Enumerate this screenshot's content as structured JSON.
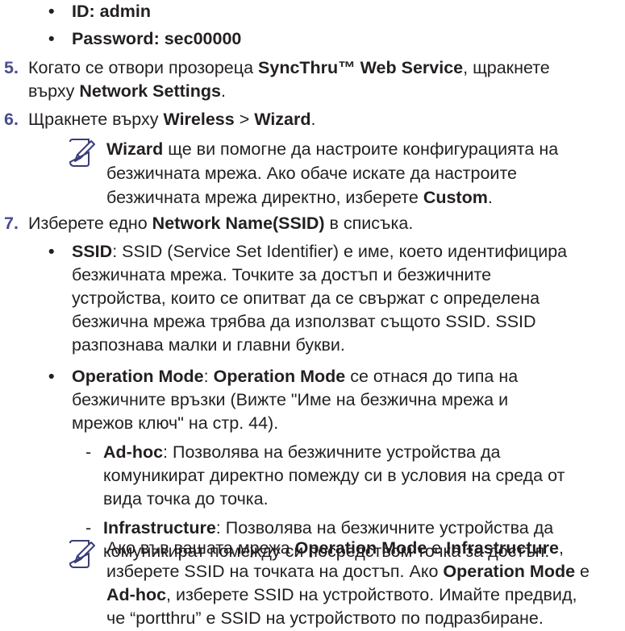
{
  "credentials": [
    {
      "bullet": "•",
      "text": "ID: admin"
    },
    {
      "bullet": "•",
      "text": "Password: sec00000"
    }
  ],
  "steps": [
    {
      "number": "5.",
      "parts": [
        "Когато се отвори прозореца ",
        "SyncThru™ Web Service",
        ", щракнете"
      ],
      "line2": [
        "върху ",
        "Network Settings",
        "."
      ]
    },
    {
      "number": "6.",
      "parts": [
        "Щракнете върху ",
        "Wireless",
        " > ",
        "Wizard",
        "."
      ]
    },
    {
      "number": "7.",
      "parts": [
        "Изберете едно ",
        "Network Name(SSID)",
        " в списъка."
      ]
    }
  ],
  "note1": {
    "icon": "note-pencil-icon",
    "line1": [
      "Wizard",
      " ще ви помогне да настроите конфигурацията на"
    ],
    "line2": "безжичната мрежа. Ако обаче искате да настроите",
    "line3": [
      "безжичната мрежа директно, изберете ",
      "Custom",
      "."
    ]
  },
  "ssid_item": {
    "bullet": "•",
    "term": "SSID",
    "lines": [
      ": SSID (Service Set Identifier) е име, което идентифицира",
      "безжичната мрежа. Точките за достъп и безжичните",
      "устройства, които се опитват да се свържат с определена",
      "безжична мрежа трябва да използват същото SSID. SSID",
      "разпознава малки и главни букви."
    ]
  },
  "opmode_item": {
    "bullet": "•",
    "term": "Operation Mode",
    "line1": [
      ": ",
      "Operation Mode",
      " се отнася до типа на"
    ],
    "lines": [
      "безжичните връзки (Вижте \"Име на безжична мрежа и",
      "мрежов ключ\" на стр. 44)."
    ]
  },
  "sub_items": [
    {
      "dash": "-",
      "term": "Ad-hoc",
      "lines": [
        ": Позволява на безжичните устройства да",
        "комуникират директно помежду си в условия на среда от",
        "вида точка до точка."
      ]
    },
    {
      "dash": "-",
      "term": "Infrastructure",
      "lines": [
        ": Позволява на безжичните устройства да",
        "комуникират помежду си посредством точка за достъп."
      ]
    }
  ],
  "note2": {
    "icon": "note-pencil-icon",
    "line1": [
      "Ако във вашата мрежа ",
      "Operation Mode",
      " е ",
      "Infrastructure",
      ","
    ],
    "line2": [
      "изберете SSID на точката на достъп. Ако ",
      "Operation Mode",
      " е"
    ],
    "line3": [
      "Ad-hoc",
      ", изберете SSID на устройството. Имайте предвид,"
    ],
    "line4": "че “portthru” е SSID на устройството по подразбиране."
  },
  "colors": {
    "text": "#231f20",
    "step_number": "#4a4c8e",
    "icon_stroke": "#3a3d7a"
  }
}
